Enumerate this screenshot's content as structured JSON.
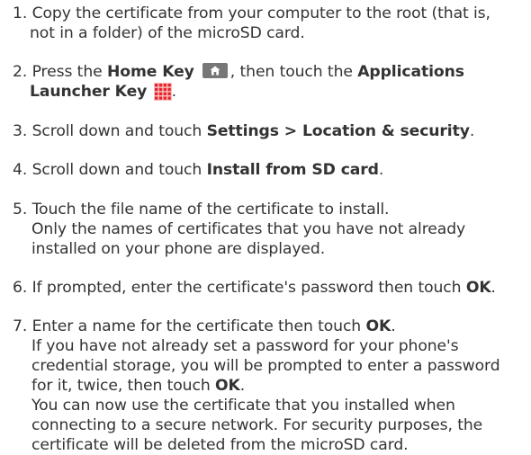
{
  "steps": [
    {
      "num": "1.",
      "lines": [
        "Copy the certificate from your computer to the root (that is,",
        "not in a folder) of the microSD card."
      ]
    },
    {
      "num": "2.",
      "text_a": "Press the ",
      "home_key": "Home Key",
      "text_b": ", then touch the ",
      "app_launcher": "Applications",
      "app_launcher_2": "Launcher Key",
      "text_c": "."
    },
    {
      "num": "3.",
      "text_a": "Scroll down and touch ",
      "bold": "Settings > Location & security",
      "text_b": "."
    },
    {
      "num": "4.",
      "text_a": "Scroll down and touch ",
      "bold": "Install from SD card",
      "text_b": "."
    },
    {
      "num": "5.",
      "line1": "Touch the file name of the certificate to install.",
      "line2": "Only the names of certificates that you have not already",
      "line3": "installed on your phone are displayed."
    },
    {
      "num": "6.",
      "text_a": "If prompted, enter the certificate's password then touch ",
      "bold": "OK",
      "text_b": "."
    },
    {
      "num": "7.",
      "line1_a": "Enter a name for the certificate then touch ",
      "line1_bold": "OK",
      "line1_b": ".",
      "line2": "If you have not already set a password for your phone's",
      "line3": "credential storage, you will be prompted to enter a password",
      "line4_a": "for it, twice, then touch ",
      "line4_bold": "OK",
      "line4_b": ".",
      "line5": "You can now use the certificate that you installed when",
      "line6": "connecting to a secure network. For security purposes, the",
      "line7": "certificate will be deleted from the microSD card."
    }
  ],
  "colors": {
    "text": "#333333",
    "home_key_bg": "#777777",
    "app_launcher_icon": "#e8232a"
  },
  "icons": {
    "home_key": "home-icon",
    "app_launcher": "applications-launcher-icon"
  }
}
